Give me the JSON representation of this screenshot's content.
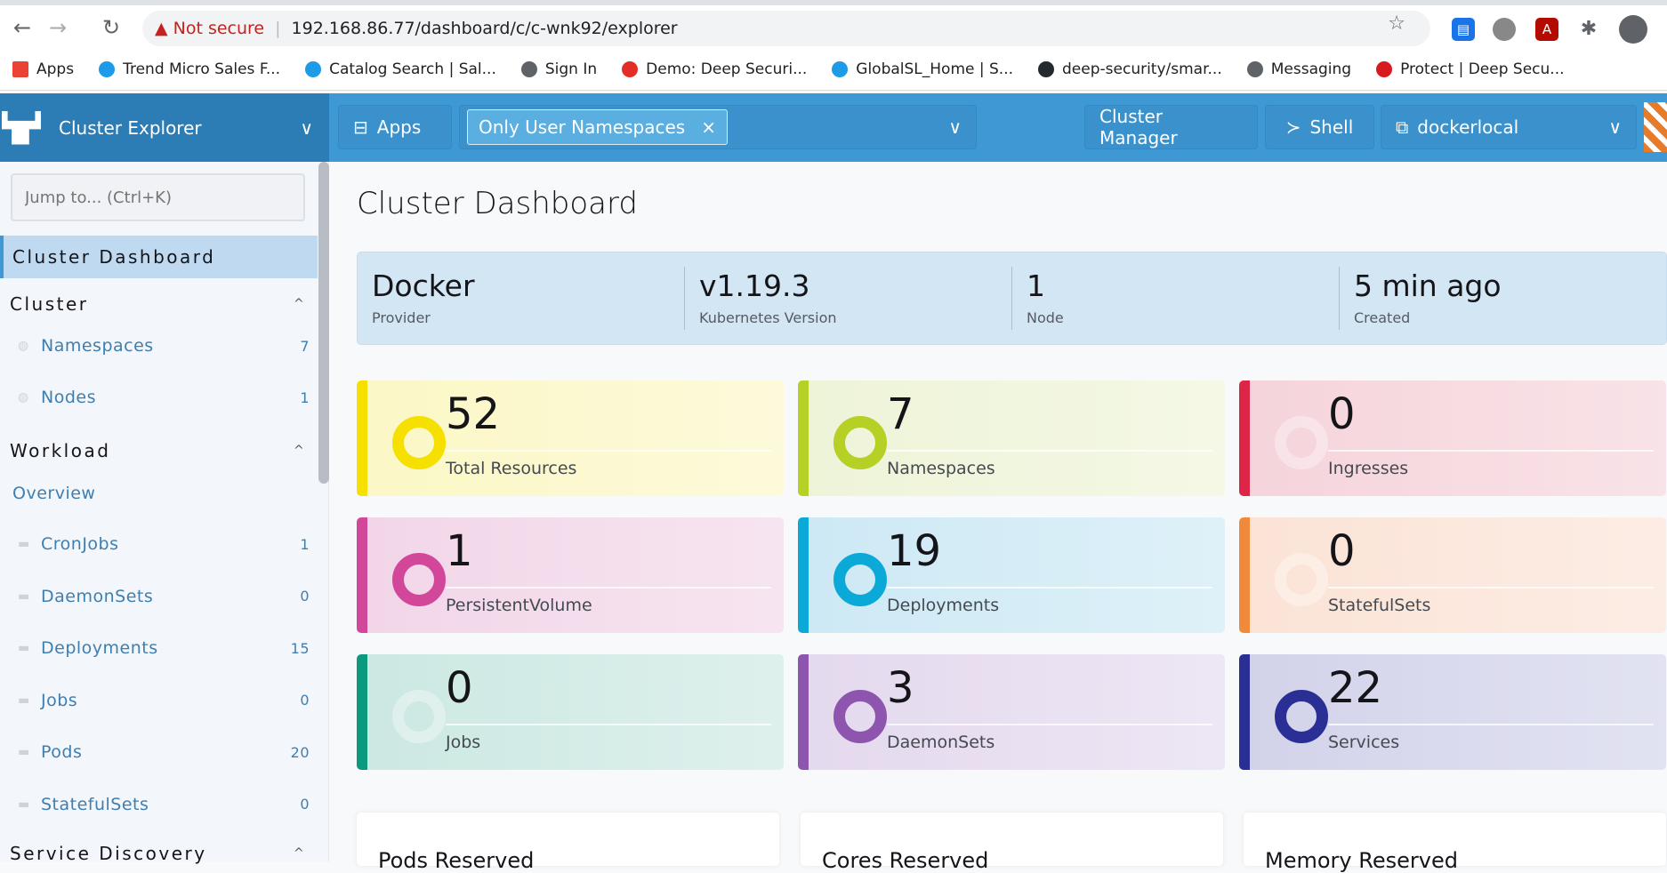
{
  "browser": {
    "url_warning": "Not secure",
    "url": "192.168.86.77/dashboard/c/c-wnk92/explorer",
    "bookmarks": [
      {
        "label": "Apps",
        "color": "#ea4335"
      },
      {
        "label": "Trend Micro Sales F...",
        "color": "#1e9be8"
      },
      {
        "label": "Catalog Search | Sal...",
        "color": "#1e9be8"
      },
      {
        "label": "Sign In",
        "color": "#5f6368"
      },
      {
        "label": "Demo: Deep Securi...",
        "color": "#e52d27"
      },
      {
        "label": "GlobalSL_Home | S...",
        "color": "#1e9be8"
      },
      {
        "label": "deep-security/smar...",
        "color": "#24292e"
      },
      {
        "label": "Messaging",
        "color": "#5f6368"
      },
      {
        "label": "Protect | Deep Secu...",
        "color": "#d71920"
      }
    ]
  },
  "header": {
    "product": "Cluster Explorer",
    "apps": "Apps",
    "namespace_filter": "Only User Namespaces",
    "cluster_manager": "Cluster Manager",
    "shell": "Shell",
    "cluster": "dockerlocal"
  },
  "sidebar": {
    "jump_placeholder": "Jump to... (Ctrl+K)",
    "active": "Cluster Dashboard",
    "groups": {
      "cluster": "Cluster",
      "workload": "Workload",
      "service_discovery": "Service Discovery"
    },
    "overview": "Overview",
    "cluster_items": [
      {
        "label": "Namespaces",
        "count": "7"
      },
      {
        "label": "Nodes",
        "count": "1"
      }
    ],
    "workload_items": [
      {
        "label": "CronJobs",
        "count": "1"
      },
      {
        "label": "DaemonSets",
        "count": "0"
      },
      {
        "label": "Deployments",
        "count": "15"
      },
      {
        "label": "Jobs",
        "count": "0"
      },
      {
        "label": "Pods",
        "count": "20"
      },
      {
        "label": "StatefulSets",
        "count": "0"
      }
    ]
  },
  "main": {
    "title": "Cluster Dashboard",
    "banner": [
      {
        "value": "Docker",
        "label": "Provider"
      },
      {
        "value": "v1.19.3",
        "label": "Kubernetes Version"
      },
      {
        "value": "1",
        "label": "Node"
      },
      {
        "value": "5 min ago",
        "label": "Created"
      }
    ],
    "cards": [
      {
        "value": "52",
        "label": "Total Resources",
        "color": "#f5e000",
        "bg": "#fbf7c6"
      },
      {
        "value": "7",
        "label": "Namespaces",
        "color": "#b6d025",
        "bg": "#eef4d8"
      },
      {
        "value": "0",
        "label": "Ingresses",
        "color": "#dc2547",
        "bg": "#f5d4db"
      },
      {
        "value": "1",
        "label": "PersistentVolume",
        "color": "#d2479a",
        "bg": "#f2d6e8"
      },
      {
        "value": "19",
        "label": "Deployments",
        "color": "#0aa9d8",
        "bg": "#cde9f5"
      },
      {
        "value": "0",
        "label": "StatefulSets",
        "color": "#f08a3a",
        "bg": "#fbe3d6"
      },
      {
        "value": "0",
        "label": "Jobs",
        "color": "#0c9a7e",
        "bg": "#cce8e2"
      },
      {
        "value": "3",
        "label": "DaemonSets",
        "color": "#8e55ae",
        "bg": "#e4d9ee"
      },
      {
        "value": "22",
        "label": "Services",
        "color": "#2a2f95",
        "bg": "#d2d3ea"
      }
    ],
    "gauges": [
      "Pods Reserved",
      "Cores Reserved",
      "Memory Reserved"
    ]
  }
}
